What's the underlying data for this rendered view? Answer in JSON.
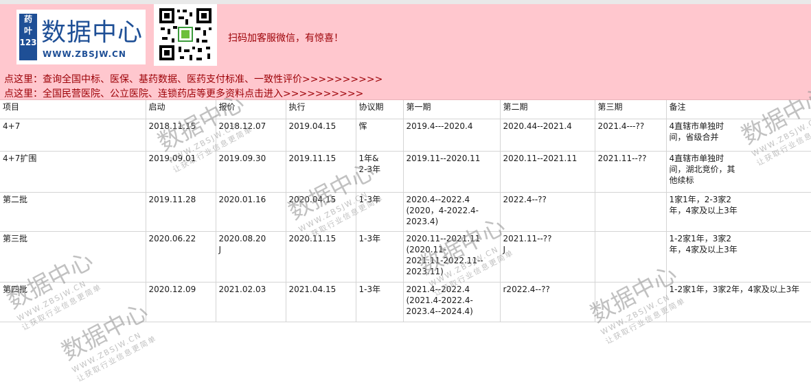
{
  "banner": {
    "logo_mark": "药\n叶\n123",
    "logo_title": "数据中心",
    "logo_url": "WWW.ZBSJW.CN",
    "qr_caption": "扫码加客服微信，有惊喜！",
    "link1": "点这里：查询全国中标、医保、基药数据、医药支付标准、一致性评价>>>>>>>>>>",
    "link2": "点这里：全国民营医院、公立医院、连锁药店等更多资料点击进入>>>>>>>>>>"
  },
  "watermark": {
    "title": "数据中心",
    "url": "WWW.ZBSJW.CN",
    "slogan": "让获取行业信息更简单"
  },
  "table": {
    "headers": [
      "项目",
      "启动",
      "报价",
      "执行",
      "协议期",
      "第一期",
      "第二期",
      "第三期",
      "备注"
    ],
    "rows": [
      [
        "4+7",
        "2018.11.15",
        "2018.12.07",
        "2019.04.15",
        "恽",
        "2019.4---2020.4",
        "2020.44--2021.4",
        "2021.4---??",
        "4直辖市单独时\n间，省级合并"
      ],
      [
        "4+7扩围",
        "2019.09.01",
        "2019.09.30",
        "2019.11.15",
        "1年&\n2-3年",
        "2019.11--2020.11",
        "2020.11--2021.11",
        "2021.11--??",
        "4直辖市单独时\n间，湖北竞价，其\n他续标"
      ],
      [
        "第二批",
        "2019.11.28",
        "2020.01.16",
        "2020.04.15",
        "1-3年",
        "2020.4--2022.4\n(2020，4-2022.4-\n2023.4)",
        "2022.4--??",
        "",
        "1家1年，2-3家2\n年，4家及以上3年"
      ],
      [
        "第三批",
        "2020.06.22",
        "2020.08.20\nJ",
        "2020.11.15",
        "1-3年",
        "2020.11--2021.11\n(2020.11-\n2021.11-2022.11--\n2023.11)",
        "2021.11--??\nJ",
        "",
        "1-2家1年，3家2\n年，4家及以上3年"
      ],
      [
        "第四批",
        "2020.12.09",
        "2021.02.03",
        "2021.04.15",
        "1-3年",
        "2021.4--2022.4\n(2021.4-2022.4-\n2023.4--2024.4)",
        "r2022.4--??",
        "",
        "1-2家1年，3家2年，4家及以上3年"
      ]
    ]
  }
}
